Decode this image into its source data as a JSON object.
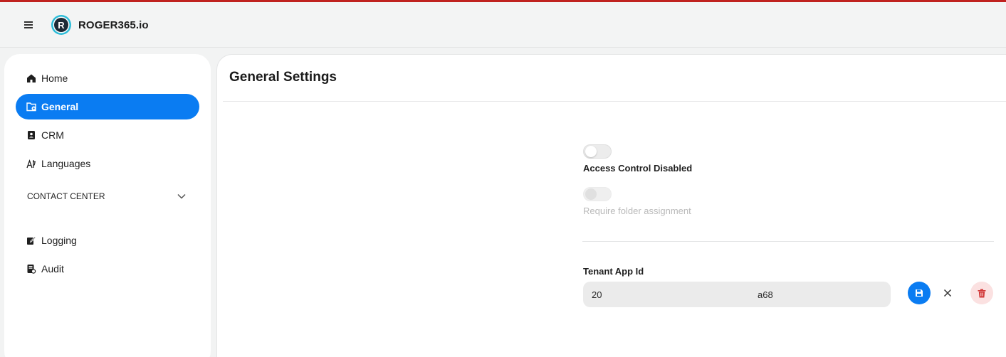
{
  "app": {
    "brand": "ROGER365.io",
    "accent_color": "#c0221f"
  },
  "header": {
    "menu_icon": "hamburger-icon",
    "logo_icon": "roger-logo"
  },
  "sidebar": {
    "items": [
      {
        "label": "Home",
        "icon": "home-icon"
      },
      {
        "label": "General",
        "icon": "settings-folder-icon",
        "active": true
      },
      {
        "label": "CRM",
        "icon": "address-book-icon"
      },
      {
        "label": "Languages",
        "icon": "translate-icon"
      }
    ],
    "section": {
      "label": "CONTACT CENTER",
      "icon": "chevron-down-icon",
      "expanded": false
    },
    "items_after": [
      {
        "label": "Logging",
        "icon": "pen-note-icon"
      },
      {
        "label": "Audit",
        "icon": "audit-icon"
      }
    ],
    "active_color": "#0a7cf2"
  },
  "main": {
    "title": "General Settings",
    "toggles": [
      {
        "label": "Access Control Disabled",
        "on": false,
        "disabled": false
      },
      {
        "label": "Require folder assignment",
        "on": false,
        "disabled": true
      }
    ],
    "tenant": {
      "label": "Tenant App Id",
      "value_start": "20",
      "value_end": "a68",
      "actions": [
        {
          "name": "save",
          "icon": "save-icon",
          "color": "#0a7cf2"
        },
        {
          "name": "cancel",
          "icon": "close-icon"
        },
        {
          "name": "delete",
          "icon": "trash-icon",
          "color": "#d23a3a"
        }
      ]
    }
  }
}
